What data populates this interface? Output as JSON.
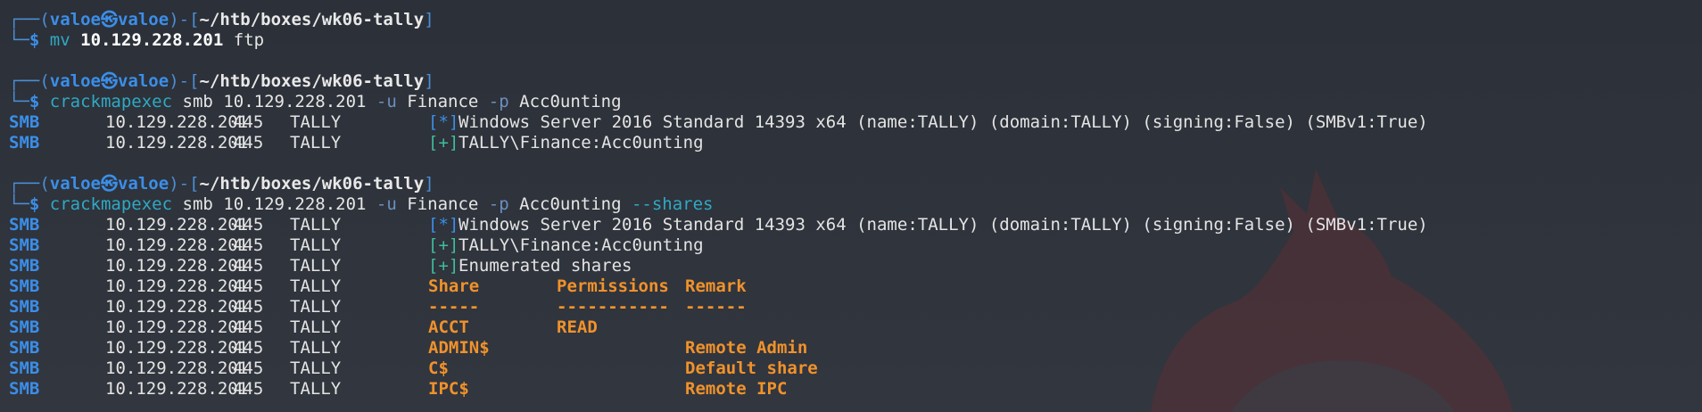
{
  "prompt": {
    "user": "valoe",
    "host": "valoe",
    "at_symbol": "㉿",
    "path": "~/htb/boxes/wk06-tally",
    "box_top_prefix": "┌──(",
    "box_mid": ")-[",
    "box_end": "]",
    "box_bottom_prefix": "└─",
    "dollar": "$"
  },
  "commands": [
    {
      "cmd": "mv",
      "args": [
        {
          "text": "10.129.228.201",
          "style": "bold"
        },
        {
          "text": "ftp",
          "style": "plain"
        }
      ]
    },
    {
      "cmd": "crackmapexec",
      "args": [
        {
          "text": "smb",
          "style": "plain"
        },
        {
          "text": "10.129.228.201",
          "style": "plain"
        },
        {
          "text": "-u",
          "style": "flag"
        },
        {
          "text": "Finance",
          "style": "plain"
        },
        {
          "text": "-p",
          "style": "flag"
        },
        {
          "text": "Acc0unting",
          "style": "plain"
        }
      ]
    },
    {
      "cmd": "crackmapexec",
      "args": [
        {
          "text": "smb",
          "style": "plain"
        },
        {
          "text": "10.129.228.201",
          "style": "plain"
        },
        {
          "text": "-u",
          "style": "flag"
        },
        {
          "text": "Finance",
          "style": "plain"
        },
        {
          "text": "-p",
          "style": "flag"
        },
        {
          "text": "Acc0unting",
          "style": "plain"
        },
        {
          "text": "--shares",
          "style": "cmd"
        }
      ]
    }
  ],
  "output1": [
    {
      "proto": "SMB",
      "ip": "10.129.228.201",
      "port": "445",
      "host": "TALLY",
      "tag": "[*]",
      "tagtype": "info",
      "msg": "Windows Server 2016 Standard 14393 x64 (name:TALLY) (domain:TALLY) (signing:False) (SMBv1:True)"
    },
    {
      "proto": "SMB",
      "ip": "10.129.228.201",
      "port": "445",
      "host": "TALLY",
      "tag": "[+]",
      "tagtype": "ok",
      "msg": "TALLY\\Finance:Acc0unting"
    }
  ],
  "output2": [
    {
      "proto": "SMB",
      "ip": "10.129.228.201",
      "port": "445",
      "host": "TALLY",
      "tag": "[*]",
      "tagtype": "info",
      "msg": "Windows Server 2016 Standard 14393 x64 (name:TALLY) (domain:TALLY) (signing:False) (SMBv1:True)"
    },
    {
      "proto": "SMB",
      "ip": "10.129.228.201",
      "port": "445",
      "host": "TALLY",
      "tag": "[+]",
      "tagtype": "ok",
      "msg": "TALLY\\Finance:Acc0unting"
    },
    {
      "proto": "SMB",
      "ip": "10.129.228.201",
      "port": "445",
      "host": "TALLY",
      "tag": "[+]",
      "tagtype": "ok",
      "msg": "Enumerated shares"
    }
  ],
  "shares": [
    {
      "proto": "SMB",
      "ip": "10.129.228.201",
      "port": "445",
      "host": "TALLY",
      "share": "Share",
      "perm": "Permissions",
      "remark": "Remark"
    },
    {
      "proto": "SMB",
      "ip": "10.129.228.201",
      "port": "445",
      "host": "TALLY",
      "share": "-----",
      "perm": "-----------",
      "remark": "------"
    },
    {
      "proto": "SMB",
      "ip": "10.129.228.201",
      "port": "445",
      "host": "TALLY",
      "share": "ACCT",
      "perm": "READ",
      "remark": ""
    },
    {
      "proto": "SMB",
      "ip": "10.129.228.201",
      "port": "445",
      "host": "TALLY",
      "share": "ADMIN$",
      "perm": "",
      "remark": "Remote Admin"
    },
    {
      "proto": "SMB",
      "ip": "10.129.228.201",
      "port": "445",
      "host": "TALLY",
      "share": "C$",
      "perm": "",
      "remark": "Default share"
    },
    {
      "proto": "SMB",
      "ip": "10.129.228.201",
      "port": "445",
      "host": "TALLY",
      "share": "IPC$",
      "perm": "",
      "remark": "Remote IPC"
    }
  ],
  "colors": {
    "background": "#2f333c",
    "prompt_blue": "#3b8ee8",
    "command_cyan": "#2fa9c4",
    "success_green": "#3fbd9a",
    "share_orange": "#f0922b"
  },
  "wallpaper_icon": "fox-silhouette"
}
